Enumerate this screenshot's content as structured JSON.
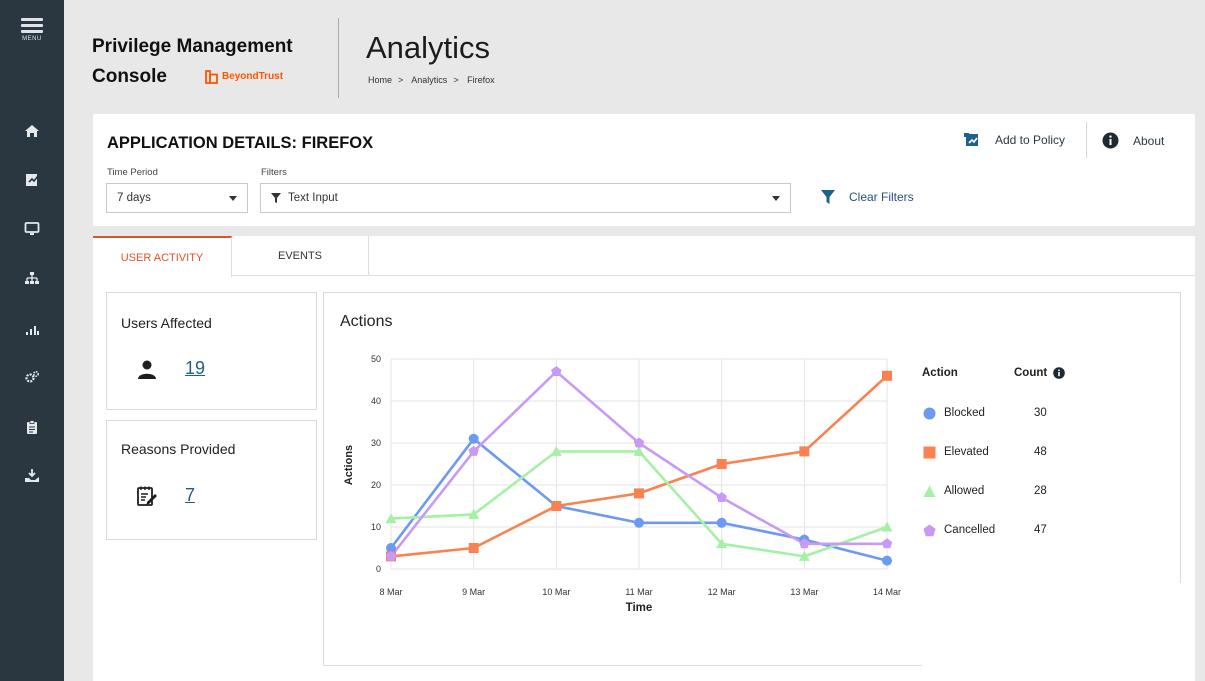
{
  "nav": {
    "menu_label": "MENU",
    "items": [
      {
        "icon": "home-icon"
      },
      {
        "icon": "policy-icon"
      },
      {
        "icon": "computer-icon"
      },
      {
        "icon": "hierarchy-icon"
      },
      {
        "icon": "analytics-icon"
      },
      {
        "icon": "settings-icon"
      },
      {
        "icon": "clipboard-icon"
      },
      {
        "icon": "deploy-icon"
      }
    ]
  },
  "header": {
    "product_line1": "Privilege Management",
    "product_line2": "Console",
    "logo_text": "BeyondTrust",
    "page_title": "Analytics",
    "breadcrumb": [
      "Home",
      "Analytics",
      "Firefox"
    ]
  },
  "details": {
    "title": "APPLICATION DETAILS: FIREFOX",
    "add_to_policy": "Add to Policy",
    "about": "About",
    "time_period_label": "Time Period",
    "time_period_value": "7 days",
    "filters_label": "Filters",
    "filters_placeholder": "Text Input",
    "clear_filters": "Clear Filters"
  },
  "tabs": [
    {
      "label": "USER ACTIVITY",
      "active": true
    },
    {
      "label": "EVENTS",
      "active": false
    }
  ],
  "stats": {
    "users_affected_label": "Users Affected",
    "users_affected_value": "19",
    "reasons_label": "Reasons Provided",
    "reasons_value": "7"
  },
  "legend": {
    "action_header": "Action",
    "count_header": "Count",
    "rows": [
      {
        "name": "Blocked",
        "count": "30"
      },
      {
        "name": "Elevated",
        "count": "48"
      },
      {
        "name": "Allowed",
        "count": "28"
      },
      {
        "name": "Cancelled",
        "count": "47"
      }
    ]
  },
  "colors": {
    "accent": "#e0522b",
    "link": "#1f5f8b",
    "blocked": "#6b9af0",
    "elevated": "#fa8150",
    "allowed": "#a5f0a5",
    "cancelled": "#c89af5"
  },
  "chart_data": {
    "type": "line",
    "title": "Actions",
    "xlabel": "Time",
    "ylabel": "Actions",
    "ylim": [
      0,
      50
    ],
    "yticks": [
      0,
      10,
      20,
      30,
      40,
      50
    ],
    "categories": [
      "8 Mar",
      "9 Mar",
      "10 Mar",
      "11 Mar",
      "12 Mar",
      "13 Mar",
      "14 Mar"
    ],
    "grid": true,
    "legend_position": "right",
    "series": [
      {
        "name": "Blocked",
        "marker": "circle",
        "color": "#6b9af0",
        "values": [
          5,
          31,
          15,
          11,
          11,
          7,
          2
        ]
      },
      {
        "name": "Elevated",
        "marker": "square",
        "color": "#fa8150",
        "values": [
          3,
          5,
          15,
          18,
          25,
          28,
          46
        ]
      },
      {
        "name": "Allowed",
        "marker": "triangle",
        "color": "#a5f0a5",
        "values": [
          12,
          13,
          28,
          28,
          6,
          3,
          10
        ]
      },
      {
        "name": "Cancelled",
        "marker": "pentagon",
        "color": "#c89af5",
        "values": [
          3,
          28,
          47,
          30,
          17,
          6,
          6
        ]
      }
    ]
  }
}
